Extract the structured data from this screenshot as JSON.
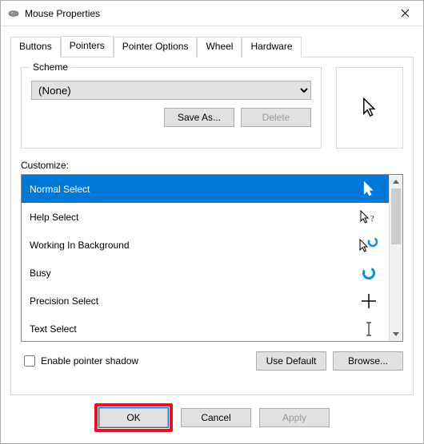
{
  "window": {
    "title": "Mouse Properties"
  },
  "tabs": [
    "Buttons",
    "Pointers",
    "Pointer Options",
    "Wheel",
    "Hardware"
  ],
  "active_tab": 1,
  "scheme": {
    "legend": "Scheme",
    "value": "(None)",
    "save_as": "Save As...",
    "delete": "Delete"
  },
  "customize_label": "Customize:",
  "cursors": [
    {
      "label": "Normal Select",
      "icon": "arrow"
    },
    {
      "label": "Help Select",
      "icon": "arrow-help"
    },
    {
      "label": "Working In Background",
      "icon": "arrow-busy"
    },
    {
      "label": "Busy",
      "icon": "busy"
    },
    {
      "label": "Precision Select",
      "icon": "cross"
    },
    {
      "label": "Text Select",
      "icon": "ibeam"
    }
  ],
  "selected_cursor": 0,
  "enable_shadow_label": "Enable pointer shadow",
  "use_default": "Use Default",
  "browse": "Browse...",
  "footer": {
    "ok": "OK",
    "cancel": "Cancel",
    "apply": "Apply"
  }
}
